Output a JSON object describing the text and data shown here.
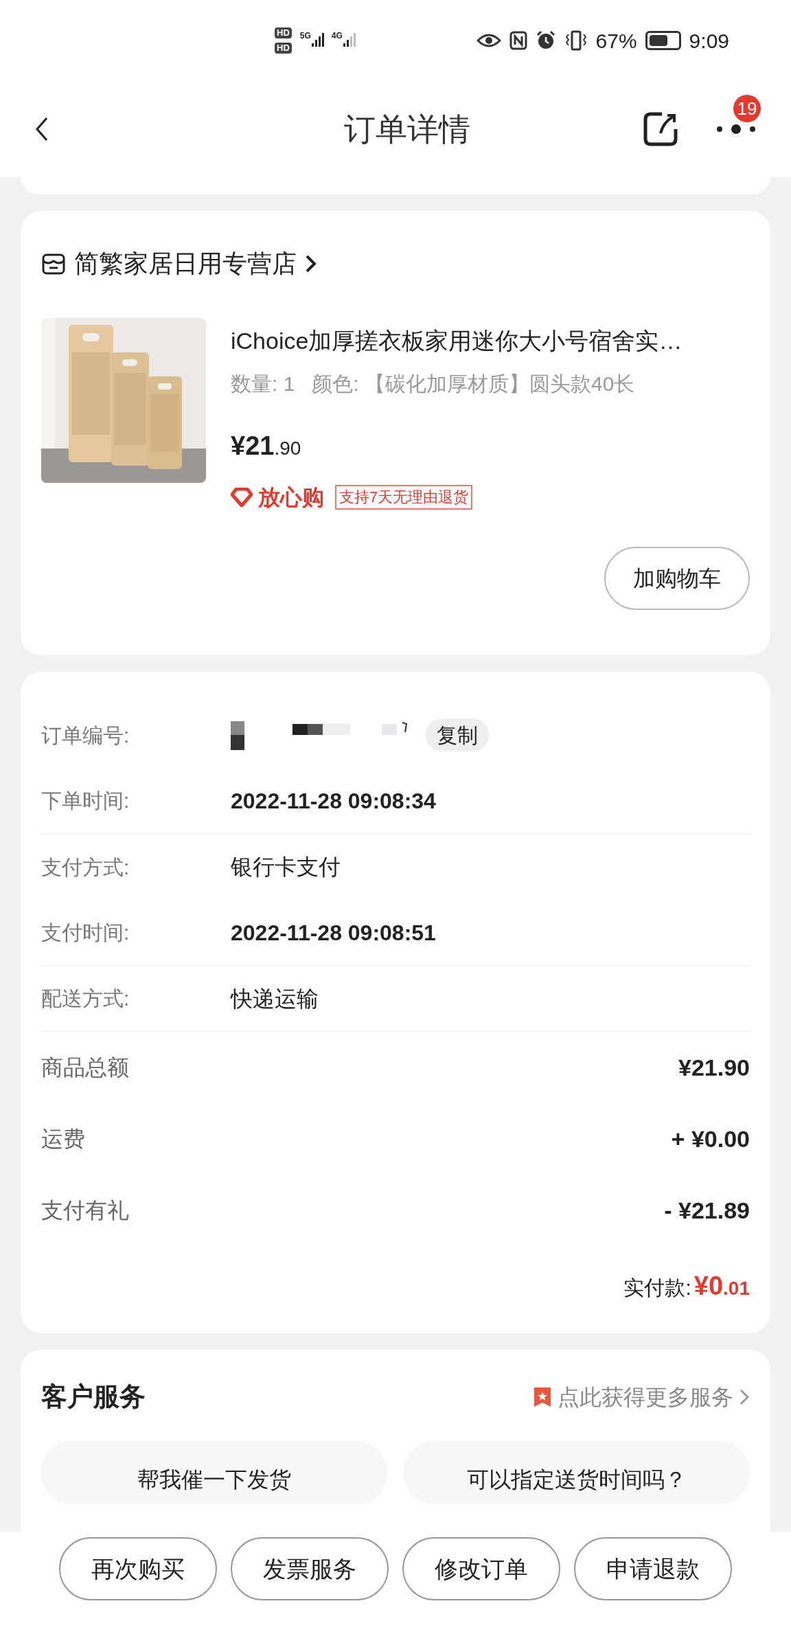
{
  "status_bar": {
    "sim_labels": [
      "HD",
      "HD"
    ],
    "networks": [
      "5G",
      "4G"
    ],
    "battery": "67%",
    "time": "9:09"
  },
  "header": {
    "title": "订单详情",
    "badge": "19"
  },
  "shop": {
    "name": "简繁家居日用专营店"
  },
  "product": {
    "kind": "picture",
    "title": "iChoice加厚搓衣板家用迷你大小号宿舍实…",
    "spec": "数量: 1   颜色: 【碳化加厚材质】圆头款40长",
    "price_main": "¥21",
    "price_cents": ".90",
    "guarantee": "放心购",
    "guarantee_tag": "支持7天无理由退货",
    "cart_button": "加购物车"
  },
  "order_info": [
    {
      "kind": "redacted",
      "label": "订单编号:",
      "action": "复制",
      "divider": false
    },
    {
      "kind": "text",
      "label": "下单时间:",
      "value": "2022-11-28 09:08:34",
      "bold": true,
      "divider": true
    },
    {
      "kind": "text",
      "label": "支付方式:",
      "value": "银行卡支付",
      "bold": false,
      "divider": false
    },
    {
      "kind": "text",
      "label": "支付时间:",
      "value": "2022-11-28 09:08:51",
      "bold": true,
      "divider": true
    },
    {
      "kind": "text",
      "label": "配送方式:",
      "value": "快递运输",
      "bold": false,
      "divider": true
    }
  ],
  "amounts": [
    {
      "label": "商品总额",
      "value": "¥21.90"
    },
    {
      "label": "运费",
      "value": "+ ¥0.00"
    },
    {
      "label": "支付有礼",
      "value": "- ¥21.89"
    }
  ],
  "paid": {
    "label": "实付款:",
    "main": "¥0",
    "cents": ".01"
  },
  "service": {
    "title": "客户服务",
    "link": "点此获得更多服务",
    "chips": [
      "帮我催一下发货",
      "可以指定送货时间吗？"
    ]
  },
  "actions": [
    "再次购买",
    "发票服务",
    "修改订单",
    "申请退款"
  ]
}
